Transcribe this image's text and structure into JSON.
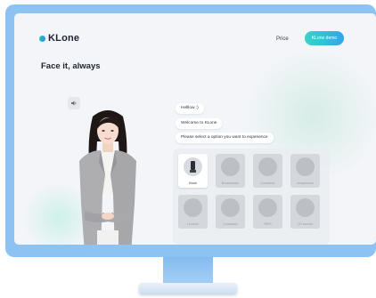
{
  "header": {
    "logo_text": "KLone",
    "nav_price": "Price",
    "demo_button": "KLone demo"
  },
  "hero": {
    "headline": "Face it, always"
  },
  "chat": {
    "messages": [
      "Helllow :)",
      "Welcome to KLone",
      "Please select a option you want to experience"
    ]
  },
  "options": [
    {
      "label": "Kiosk",
      "active": true
    },
    {
      "label": "Broadcaster",
      "active": false
    },
    {
      "label": "Counselor",
      "active": false
    },
    {
      "label": "receptionist",
      "active": false
    },
    {
      "label": "Lecturer",
      "active": false
    },
    {
      "label": "Counselor",
      "active": false
    },
    {
      "label": "MRS",
      "active": false
    },
    {
      "label": "CS service",
      "active": false
    }
  ],
  "colors": {
    "monitor_frame": "#8cc3f2",
    "screen_bg": "#f3f5f8",
    "accent_start": "#3ad4c8",
    "accent_end": "#2fa6ea"
  }
}
